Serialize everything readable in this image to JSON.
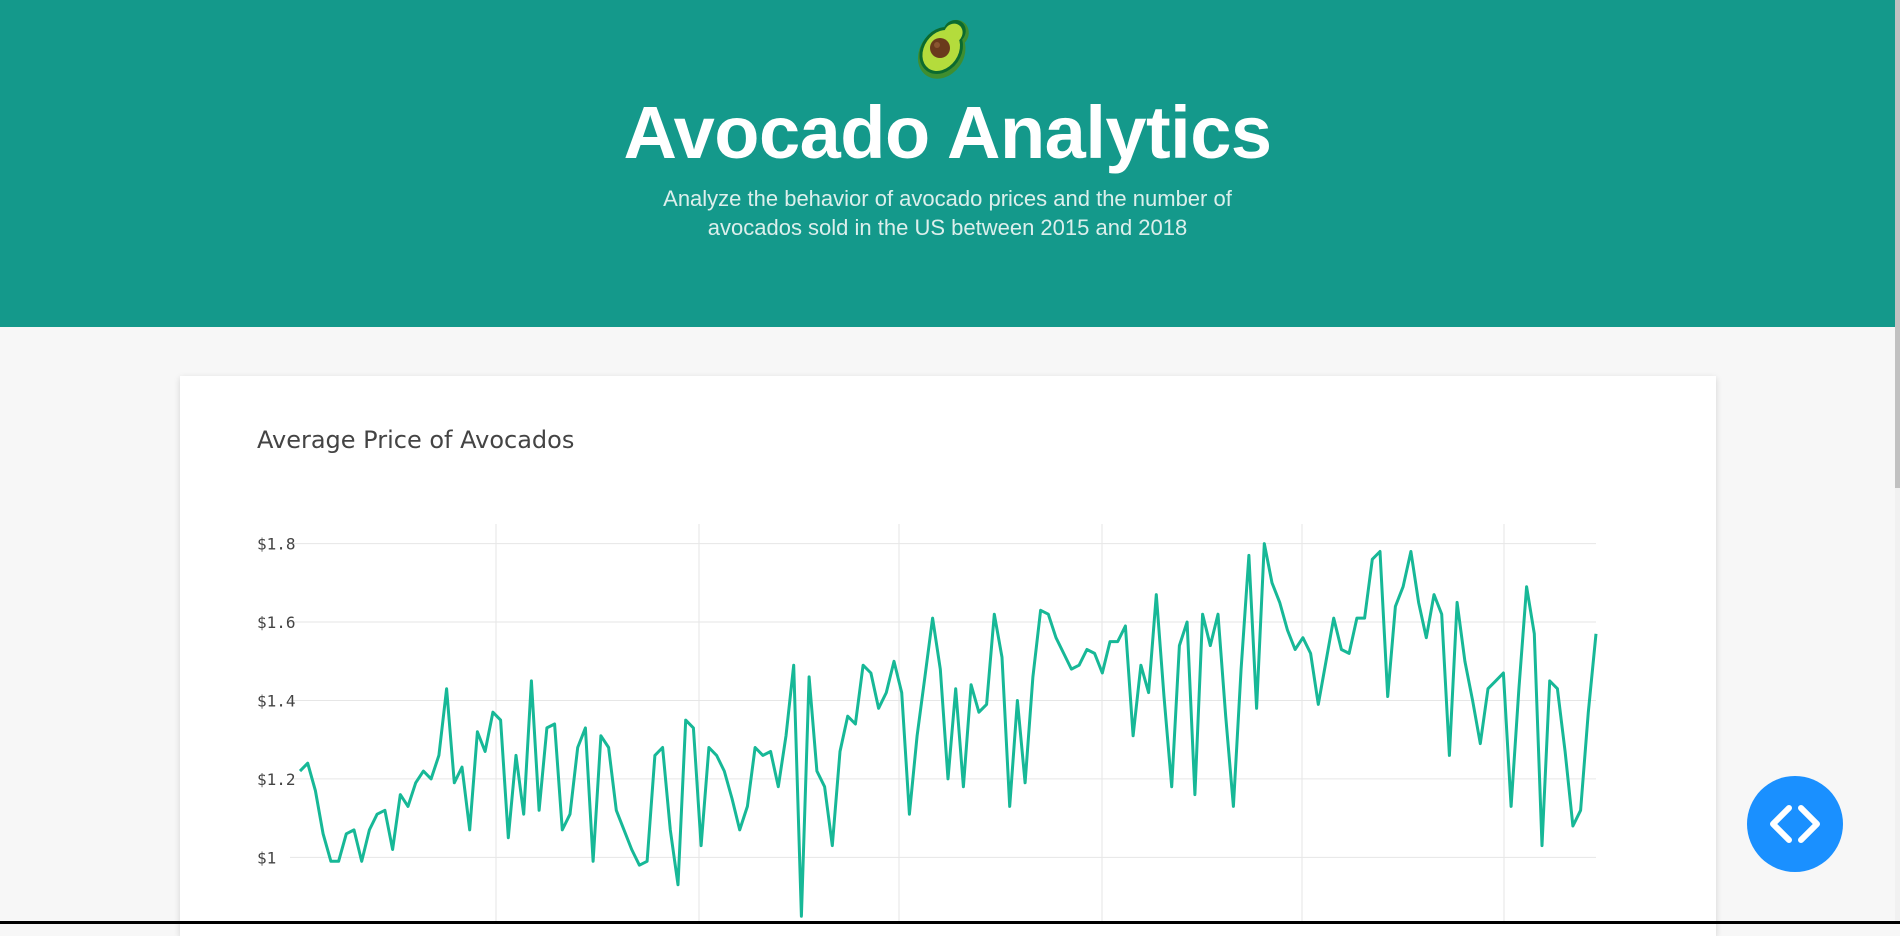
{
  "header": {
    "logo_icon": "avocado-icon",
    "title": "Avocado Analytics",
    "subtitle": "Analyze the behavior of avocado prices and the number of avocados sold in the US between 2015 and 2018"
  },
  "colors": {
    "header_bg": "#14998b",
    "line": "#17b897",
    "fab": "#1a90ff"
  },
  "chart": {
    "title": "Average Price of Avocados"
  },
  "chart_data": {
    "type": "line",
    "title": "Average Price of Avocados",
    "xlabel": "",
    "ylabel": "",
    "ylim": [
      0.83,
      1.85
    ],
    "yticks": [
      {
        "value": 1.8,
        "label": "$1.8"
      },
      {
        "value": 1.6,
        "label": "$1.6"
      },
      {
        "value": 1.4,
        "label": "$1.4"
      },
      {
        "value": 1.2,
        "label": "$1.2"
      },
      {
        "value": 1.0,
        "label": "$1"
      }
    ],
    "grid": true,
    "series": [
      {
        "values": [
          1.22,
          1.24,
          1.17,
          1.06,
          0.99,
          0.99,
          1.06,
          1.07,
          0.99,
          1.07,
          1.11,
          1.12,
          1.02,
          1.16,
          1.13,
          1.19,
          1.22,
          1.2,
          1.26,
          1.43,
          1.19,
          1.23,
          1.07,
          1.32,
          1.27,
          1.37,
          1.35,
          1.05,
          1.26,
          1.11,
          1.45,
          1.12,
          1.33,
          1.34,
          1.07,
          1.11,
          1.28,
          1.33,
          0.99,
          1.31,
          1.28,
          1.12,
          1.07,
          1.02,
          0.98,
          0.99,
          1.26,
          1.28,
          1.07,
          0.93,
          1.35,
          1.33,
          1.03,
          1.28,
          1.26,
          1.22,
          1.15,
          1.07,
          1.13,
          1.28,
          1.26,
          1.27,
          1.18,
          1.31,
          1.49,
          0.85,
          1.46,
          1.22,
          1.18,
          1.03,
          1.27,
          1.36,
          1.34,
          1.49,
          1.47,
          1.38,
          1.42,
          1.5,
          1.42,
          1.11,
          1.31,
          1.46,
          1.61,
          1.48,
          1.2,
          1.43,
          1.18,
          1.44,
          1.37,
          1.39,
          1.62,
          1.51,
          1.13,
          1.4,
          1.19,
          1.46,
          1.63,
          1.62,
          1.56,
          1.52,
          1.48,
          1.49,
          1.53,
          1.52,
          1.47,
          1.55,
          1.55,
          1.59,
          1.31,
          1.49,
          1.42,
          1.67,
          1.41,
          1.18,
          1.54,
          1.6,
          1.16,
          1.62,
          1.54,
          1.62,
          1.36,
          1.13,
          1.48,
          1.77,
          1.38,
          1.8,
          1.7,
          1.65,
          1.58,
          1.53,
          1.56,
          1.52,
          1.39,
          1.5,
          1.61,
          1.53,
          1.52,
          1.61,
          1.61,
          1.76,
          1.78,
          1.41,
          1.64,
          1.69,
          1.78,
          1.65,
          1.56,
          1.67,
          1.62,
          1.26,
          1.65,
          1.5,
          1.4,
          1.29,
          1.43,
          1.45,
          1.47,
          1.13,
          1.43,
          1.69,
          1.57,
          1.03,
          1.45,
          1.43,
          1.27,
          1.08,
          1.12,
          1.37,
          1.57
        ]
      }
    ]
  }
}
